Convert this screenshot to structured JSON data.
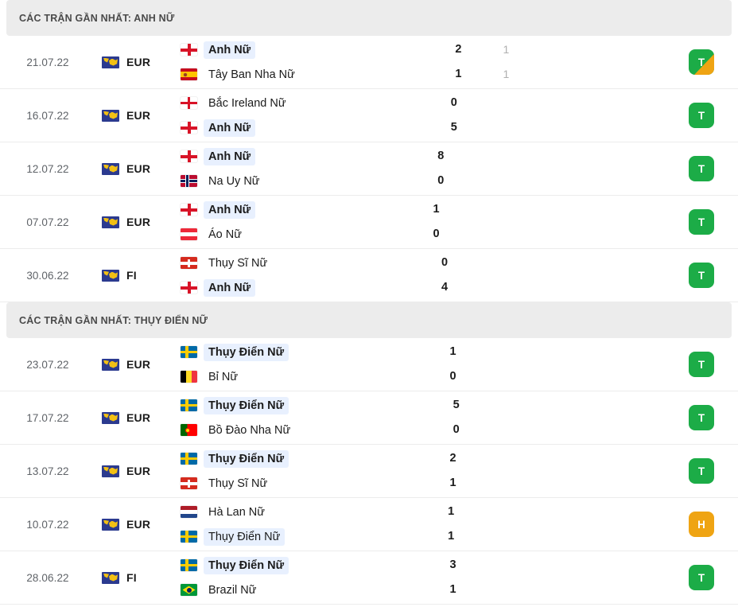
{
  "sections": [
    {
      "id": "anh-nu",
      "title": "CÁC TRẬN GẦN NHẤT: ANH NỮ",
      "matches": [
        {
          "date": "21.07.22",
          "competition": "EUR",
          "competition_icon": "uefa-map-icon",
          "home": {
            "name": "Anh Nữ",
            "flag": "eng",
            "flag_name": "flag-england",
            "winner": true,
            "highlight": true
          },
          "away": {
            "name": "Tây Ban Nha Nữ",
            "flag": "esp",
            "flag_name": "flag-spain",
            "winner": false,
            "highlight": false
          },
          "score_home": "2",
          "score_away": "1",
          "score2_home": "1",
          "score2_away": "1",
          "badge": {
            "letter": "T",
            "type": "win",
            "wedge": true
          }
        },
        {
          "date": "16.07.22",
          "competition": "EUR",
          "competition_icon": "uefa-map-icon",
          "home": {
            "name": "Bắc Ireland Nữ",
            "flag": "nir",
            "flag_name": "flag-northern-ireland",
            "winner": false,
            "highlight": false
          },
          "away": {
            "name": "Anh Nữ",
            "flag": "eng",
            "flag_name": "flag-england",
            "winner": true,
            "highlight": true
          },
          "score_home": "0",
          "score_away": "5",
          "score2_home": "",
          "score2_away": "",
          "badge": {
            "letter": "T",
            "type": "win",
            "wedge": false
          }
        },
        {
          "date": "12.07.22",
          "competition": "EUR",
          "competition_icon": "uefa-map-icon",
          "home": {
            "name": "Anh Nữ",
            "flag": "eng",
            "flag_name": "flag-england",
            "winner": true,
            "highlight": true
          },
          "away": {
            "name": "Na Uy Nữ",
            "flag": "nor",
            "flag_name": "flag-norway",
            "winner": false,
            "highlight": false
          },
          "score_home": "8",
          "score_away": "0",
          "score2_home": "",
          "score2_away": "",
          "badge": {
            "letter": "T",
            "type": "win",
            "wedge": false
          }
        },
        {
          "date": "07.07.22",
          "competition": "EUR",
          "competition_icon": "uefa-map-icon",
          "home": {
            "name": "Anh Nữ",
            "flag": "eng",
            "flag_name": "flag-england",
            "winner": true,
            "highlight": true
          },
          "away": {
            "name": "Áo Nữ",
            "flag": "aut",
            "flag_name": "flag-austria",
            "winner": false,
            "highlight": false
          },
          "score_home": "1",
          "score_away": "0",
          "score2_home": "",
          "score2_away": "",
          "badge": {
            "letter": "T",
            "type": "win",
            "wedge": false
          }
        },
        {
          "date": "30.06.22",
          "competition": "FI",
          "competition_icon": "uefa-map-icon",
          "home": {
            "name": "Thụy Sĩ Nữ",
            "flag": "sui",
            "flag_name": "flag-switzerland",
            "winner": false,
            "highlight": false
          },
          "away": {
            "name": "Anh Nữ",
            "flag": "eng",
            "flag_name": "flag-england",
            "winner": true,
            "highlight": true
          },
          "score_home": "0",
          "score_away": "4",
          "score2_home": "",
          "score2_away": "",
          "badge": {
            "letter": "T",
            "type": "win",
            "wedge": false
          }
        }
      ]
    },
    {
      "id": "thuy-dien-nu",
      "title": "CÁC TRẬN GẦN NHẤT: THỤY ĐIỂN NỮ",
      "matches": [
        {
          "date": "23.07.22",
          "competition": "EUR",
          "competition_icon": "uefa-map-icon",
          "home": {
            "name": "Thụy Điển Nữ",
            "flag": "swe",
            "flag_name": "flag-sweden",
            "winner": true,
            "highlight": true
          },
          "away": {
            "name": "Bỉ Nữ",
            "flag": "bel",
            "flag_name": "flag-belgium",
            "winner": false,
            "highlight": false
          },
          "score_home": "1",
          "score_away": "0",
          "score2_home": "",
          "score2_away": "",
          "badge": {
            "letter": "T",
            "type": "win",
            "wedge": false
          }
        },
        {
          "date": "17.07.22",
          "competition": "EUR",
          "competition_icon": "uefa-map-icon",
          "home": {
            "name": "Thụy Điển Nữ",
            "flag": "swe",
            "flag_name": "flag-sweden",
            "winner": true,
            "highlight": true
          },
          "away": {
            "name": "Bồ Đào Nha Nữ",
            "flag": "por",
            "flag_name": "flag-portugal",
            "winner": false,
            "highlight": false
          },
          "score_home": "5",
          "score_away": "0",
          "score2_home": "",
          "score2_away": "",
          "badge": {
            "letter": "T",
            "type": "win",
            "wedge": false
          }
        },
        {
          "date": "13.07.22",
          "competition": "EUR",
          "competition_icon": "uefa-map-icon",
          "home": {
            "name": "Thụy Điển Nữ",
            "flag": "swe",
            "flag_name": "flag-sweden",
            "winner": true,
            "highlight": true
          },
          "away": {
            "name": "Thụy Sĩ Nữ",
            "flag": "sui",
            "flag_name": "flag-switzerland",
            "winner": false,
            "highlight": false
          },
          "score_home": "2",
          "score_away": "1",
          "score2_home": "",
          "score2_away": "",
          "badge": {
            "letter": "T",
            "type": "win",
            "wedge": false
          }
        },
        {
          "date": "10.07.22",
          "competition": "EUR",
          "competition_icon": "uefa-map-icon",
          "home": {
            "name": "Hà Lan Nữ",
            "flag": "ned",
            "flag_name": "flag-netherlands",
            "winner": false,
            "highlight": false
          },
          "away": {
            "name": "Thụy Điển Nữ",
            "flag": "swe",
            "flag_name": "flag-sweden",
            "winner": false,
            "highlight": true
          },
          "score_home": "1",
          "score_away": "1",
          "score2_home": "",
          "score2_away": "",
          "badge": {
            "letter": "H",
            "type": "draw",
            "wedge": false
          }
        },
        {
          "date": "28.06.22",
          "competition": "FI",
          "competition_icon": "uefa-map-icon",
          "home": {
            "name": "Thụy Điển Nữ",
            "flag": "swe",
            "flag_name": "flag-sweden",
            "winner": true,
            "highlight": true
          },
          "away": {
            "name": "Brazil Nữ",
            "flag": "bra",
            "flag_name": "flag-brazil",
            "winner": false,
            "highlight": false
          },
          "score_home": "3",
          "score_away": "1",
          "score2_home": "",
          "score2_away": "",
          "badge": {
            "letter": "T",
            "type": "win",
            "wedge": false
          }
        }
      ]
    }
  ],
  "colors": {
    "win_badge": "#1cac47",
    "draw_badge": "#efa413",
    "header_bg": "#ececec",
    "highlight_bg": "#e8f0fe"
  }
}
